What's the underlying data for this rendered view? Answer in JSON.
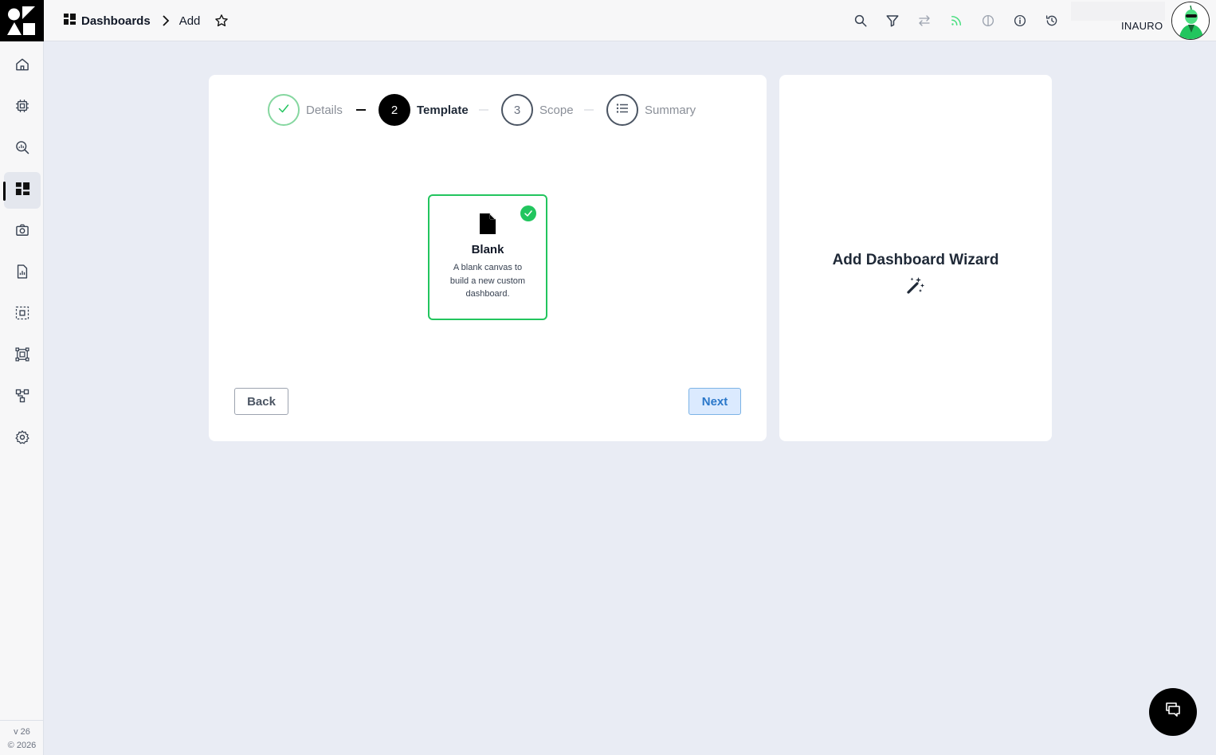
{
  "breadcrumb": {
    "section": "Dashboards",
    "current": "Add"
  },
  "topbar": {
    "icons": [
      "search-icon",
      "filter-icon",
      "swap-icon",
      "feed-icon",
      "theme-icon",
      "info-icon",
      "history-icon"
    ],
    "org_name": "INAURO"
  },
  "sidebar": {
    "items": [
      "home",
      "devices",
      "explore",
      "dashboards",
      "camera",
      "reports",
      "selection",
      "groups",
      "hierarchy",
      "settings"
    ],
    "active": "dashboards",
    "version": "v 26",
    "copyright": "© 2026"
  },
  "wizard": {
    "steps": [
      {
        "label": "Details",
        "marker": "",
        "state": "complete"
      },
      {
        "label": "Template",
        "marker": "2",
        "state": "current"
      },
      {
        "label": "Scope",
        "marker": "3",
        "state": "pending"
      },
      {
        "label": "Summary",
        "marker": "",
        "state": "pending"
      }
    ],
    "template": {
      "title": "Blank",
      "description": "A blank canvas to build a new custom dashboard.",
      "selected": true
    },
    "back_label": "Back",
    "next_label": "Next"
  },
  "side_panel": {
    "title": "Add Dashboard Wizard",
    "icon": "magic-wand-icon"
  },
  "colors": {
    "accent_green": "#22c55e",
    "primary_blue": "#2a77c9",
    "background": "#e9ecf4"
  }
}
